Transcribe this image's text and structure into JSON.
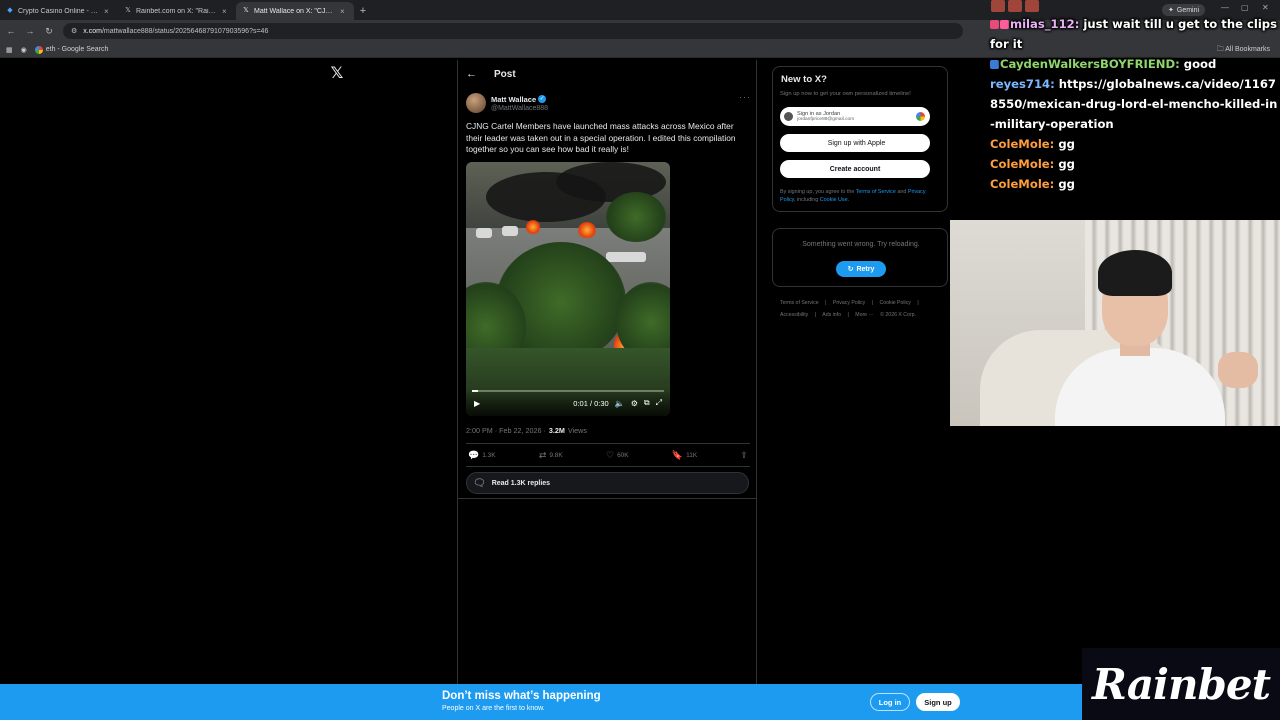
{
  "browser": {
    "tabs": [
      {
        "label": "Crypto Casino Online - Play wit",
        "favicon": "casino-icon",
        "active": false
      },
      {
        "label": "Rainbet.com on X: \"Rainbet Xm",
        "favicon": "x-icon",
        "active": false
      },
      {
        "label": "Matt Wallace on X: \"CJNG Carte",
        "favicon": "x-icon",
        "active": true
      }
    ],
    "new_tab_glyph": "+",
    "gemini_label": "Gemini",
    "address": {
      "host": "x.com",
      "path": "/mattwallace888/status/2025646879107903596?s=46"
    },
    "bookmarks": [
      {
        "label": "eth - Google Search"
      }
    ],
    "all_bookmarks_label": "All Bookmarks"
  },
  "post": {
    "header_title": "Post",
    "author_name": "Matt Wallace",
    "author_handle": "@MattWallace888",
    "text": "CJNG Cartel Members have launched mass attacks across Mexico after their leader was taken out in a special operation. I edited this compilation together so you can see how bad it really is!",
    "video": {
      "time": "0:01 / 0:30",
      "progress": 0.033
    },
    "timestamp": "2:00 PM · Feb 22, 2026 ·",
    "views_count": "3.2M",
    "views_label": "Views",
    "stats": {
      "replies": "1.3K",
      "reposts": "9.8K",
      "likes": "60K",
      "bookmarks": "11K"
    },
    "read_replies_label": "Read 1.3K replies"
  },
  "sidebar": {
    "new_to_x_title": "New to X?",
    "new_to_x_sub": "Sign up now to get your own personalized timeline!",
    "google_signin_line1": "Sign in as Jordan",
    "google_signin_line2": "jordanfprice88@gmail.com",
    "apple_label": "Sign up with Apple",
    "create_account_label": "Create account",
    "terms_prefix": "By signing up, you agree to the",
    "terms_link": "Terms of Service",
    "terms_and": "and",
    "privacy_link": "Privacy Policy",
    "terms_including": ", including",
    "cookie_link": "Cookie Use.",
    "error_text": "Something went wrong. Try reloading.",
    "retry_label": "Retry",
    "footer_links": [
      "Terms of Service",
      "|",
      "Privacy Policy",
      "|",
      "Cookie Policy",
      "|",
      "Accessibility",
      "|",
      "Ads info",
      "|",
      "More ···",
      "© 2026 X Corp."
    ]
  },
  "chat": {
    "messages": [
      {
        "user": "milas_112:",
        "text": " just wait till u get to the clips for it",
        "user_class": "u-milas"
      },
      {
        "user": "CaydenWalkersBOYFRIEND:",
        "text": " good",
        "user_class": "u-cayden"
      },
      {
        "user": "reyes714:",
        "text": " https://globalnews.ca/video/11678550/mexican-drug-lord-el-mencho-killed-in-military-operation",
        "user_class": "u-reyes"
      },
      {
        "user": "ColeMole:",
        "text": " gg",
        "user_class": "u-cole"
      },
      {
        "user": "ColeMole:",
        "text": " gg",
        "user_class": "u-cole"
      },
      {
        "user": "ColeMole:",
        "text": " gg",
        "user_class": "u-cole"
      }
    ]
  },
  "banner": {
    "title": "Don’t miss what’s happening",
    "subtitle": "People on X are the first to know.",
    "login_label": "Log in",
    "signup_label": "Sign up"
  },
  "brand_logo_text": "Rainbet",
  "colors": {
    "x_blue": "#1d9bf0",
    "background": "#000000",
    "border": "#2f3336"
  }
}
